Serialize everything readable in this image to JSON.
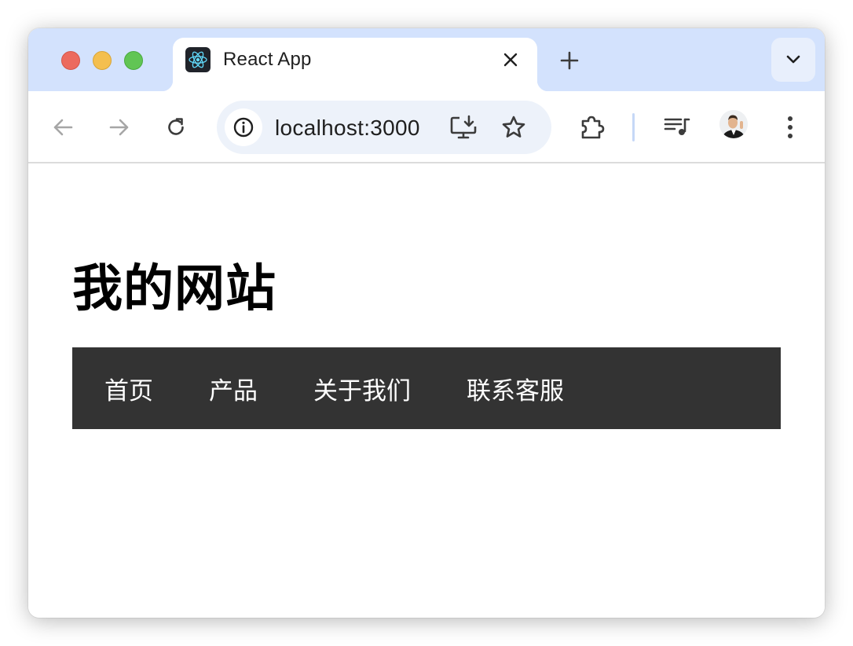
{
  "browser": {
    "tab": {
      "title": "React App",
      "favicon": "react-logo-icon",
      "close_icon": "close-icon"
    },
    "new_tab_icon": "plus-icon",
    "tab_search_icon": "chevron-down-icon",
    "toolbar": {
      "back_icon": "arrow-left-icon",
      "forward_icon": "arrow-right-icon",
      "reload_icon": "reload-icon",
      "site_info_icon": "info-icon",
      "url": "localhost:3000",
      "install_icon": "install-app-icon",
      "bookmark_icon": "star-icon",
      "extensions_icon": "puzzle-icon",
      "media_icon": "media-queue-icon",
      "profile": "avatar",
      "menu_icon": "more-vertical-icon"
    },
    "colors": {
      "tabstrip": "#d3e2fd",
      "omnibox": "#edf2fa",
      "close_red": "#ec6a5e",
      "minimize_yellow": "#f4bf4f",
      "zoom_green": "#61c554"
    }
  },
  "page": {
    "title": "我的网站",
    "nav": [
      {
        "label": "首页"
      },
      {
        "label": "产品"
      },
      {
        "label": "关于我们"
      },
      {
        "label": "联系客服"
      }
    ],
    "colors": {
      "navbar_bg": "#333333",
      "nav_text": "#ffffff"
    }
  }
}
